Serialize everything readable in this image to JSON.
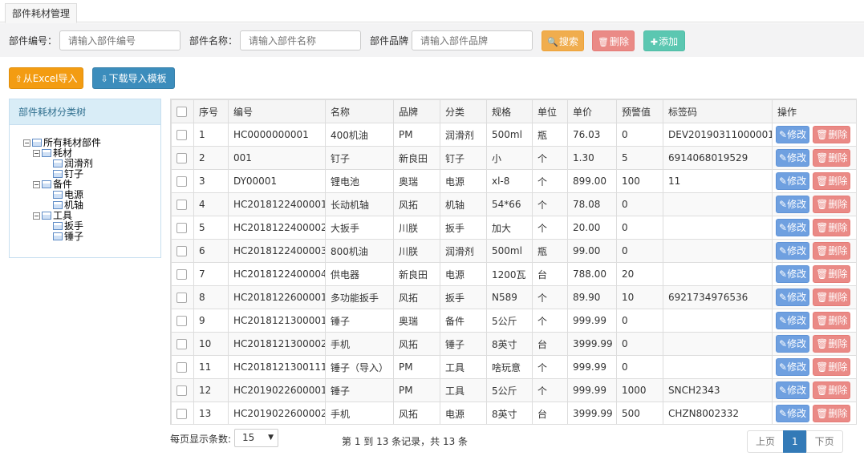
{
  "tab": {
    "label": "部件耗材管理"
  },
  "search": {
    "code_label": "部件编号：",
    "code_placeholder": "请输入部件编号",
    "name_label": "部件名称：",
    "name_placeholder": "请输入部件名称",
    "brand_label": "部件品牌",
    "brand_placeholder": "请输入部件品牌",
    "search_btn": "搜索",
    "delete_btn": "删除",
    "add_btn": "添加"
  },
  "actions": {
    "import_excel": "从Excel导入",
    "download_template": "下载导入模板"
  },
  "tree": {
    "title": "部件耗材分类树",
    "root": "所有耗材部件",
    "groups": [
      {
        "label": "耗材",
        "children": [
          "润滑剂",
          "钉子"
        ]
      },
      {
        "label": "备件",
        "children": [
          "电源",
          "机轴"
        ]
      },
      {
        "label": "工具",
        "children": [
          "扳手",
          "锤子"
        ]
      }
    ]
  },
  "table": {
    "headers": [
      "序号",
      "编号",
      "名称",
      "品牌",
      "分类",
      "规格",
      "单位",
      "单价",
      "预警值",
      "标签码",
      "操作"
    ],
    "edit_label": "修改",
    "delete_label": "删除",
    "rows": [
      [
        "1",
        "HC0000000001",
        "400机油",
        "PM",
        "润滑剂",
        "500ml",
        "瓶",
        "76.03",
        "0",
        "DEV20190311000001"
      ],
      [
        "2",
        "001",
        "钉子",
        "新良田",
        "钉子",
        "小",
        "个",
        "1.30",
        "5",
        "6914068019529"
      ],
      [
        "3",
        "DY00001",
        "锂电池",
        "奥瑞",
        "电源",
        "xl-8",
        "个",
        "899.00",
        "100",
        "11"
      ],
      [
        "4",
        "HC2018122400001",
        "长动机轴",
        "风拓",
        "机轴",
        "54*66",
        "个",
        "78.08",
        "0",
        ""
      ],
      [
        "5",
        "HC2018122400002",
        "大扳手",
        "川朕",
        "扳手",
        "加大",
        "个",
        "20.00",
        "0",
        ""
      ],
      [
        "6",
        "HC2018122400003",
        "800机油",
        "川朕",
        "润滑剂",
        "500ml",
        "瓶",
        "99.00",
        "0",
        ""
      ],
      [
        "7",
        "HC2018122400004",
        "供电器",
        "新良田",
        "电源",
        "1200瓦",
        "台",
        "788.00",
        "20",
        ""
      ],
      [
        "8",
        "HC2018122600001",
        "多功能扳手",
        "风拓",
        "扳手",
        "N589",
        "个",
        "89.90",
        "10",
        "6921734976536"
      ],
      [
        "9",
        "HC2018121300001",
        "锤子",
        "奥瑞",
        "备件",
        "5公斤",
        "个",
        "999.99",
        "0",
        ""
      ],
      [
        "10",
        "HC2018121300002",
        "手机",
        "风拓",
        "锤子",
        "8英寸",
        "台",
        "3999.99",
        "0",
        ""
      ],
      [
        "11",
        "HC2018121300111",
        "锤子（导入）",
        "PM",
        "工具",
        "啥玩意",
        "个",
        "999.99",
        "0",
        ""
      ],
      [
        "12",
        "HC2019022600001",
        "锤子",
        "PM",
        "工具",
        "5公斤",
        "个",
        "999.99",
        "1000",
        "SNCH2343"
      ],
      [
        "13",
        "HC2019022600002",
        "手机",
        "风拓",
        "电源",
        "8英寸",
        "台",
        "3999.99",
        "500",
        "CHZN8002332"
      ]
    ]
  },
  "footer": {
    "page_size_label": "每页显示条数:",
    "page_size": "15",
    "info": "第 1 到 13 条记录，共 13 条",
    "prev": "上页",
    "current": "1",
    "next": "下页"
  }
}
